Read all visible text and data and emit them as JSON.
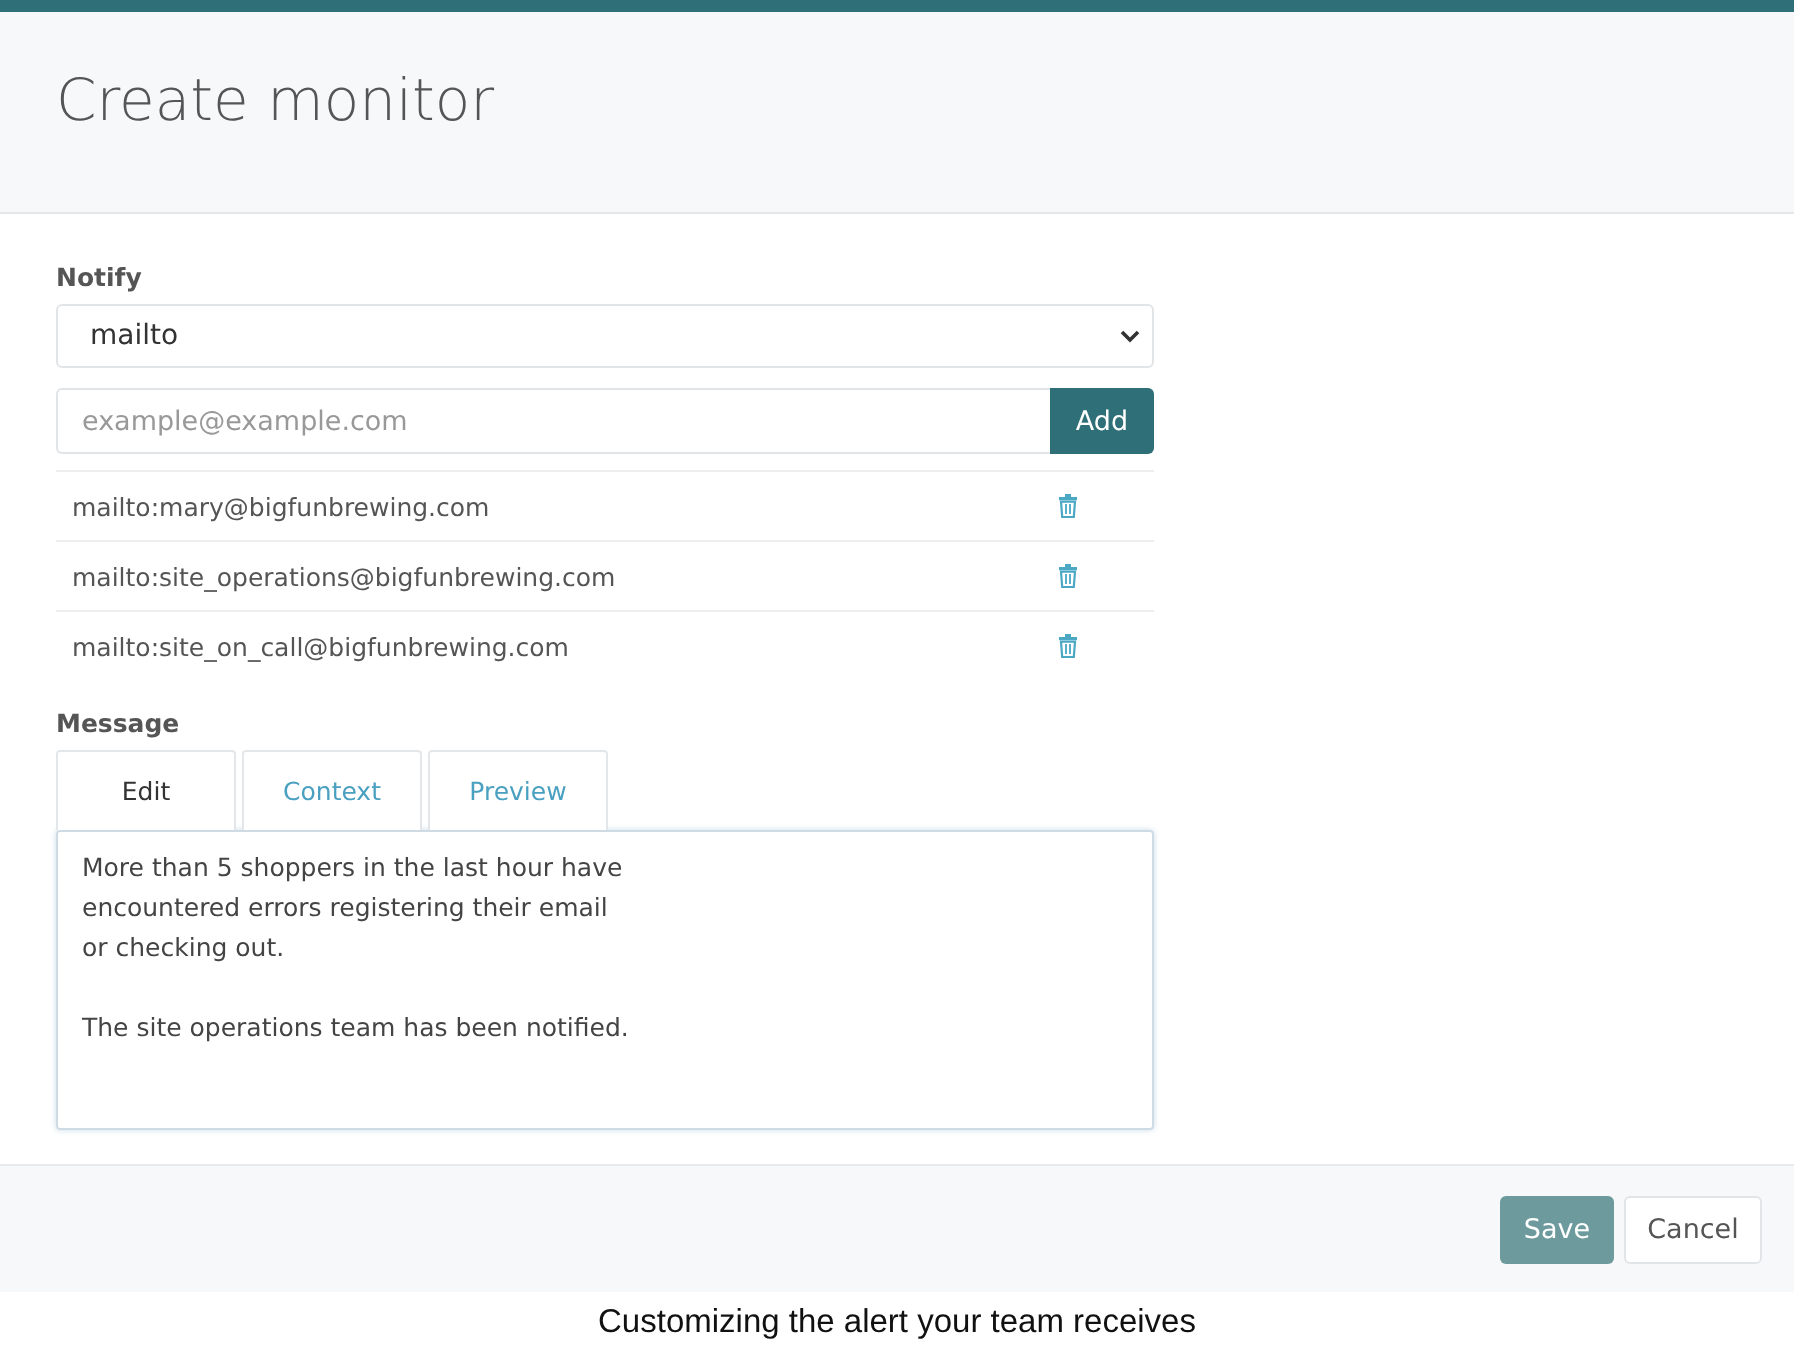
{
  "dialog": {
    "title": "Create monitor"
  },
  "notify": {
    "label": "Notify",
    "channel": "mailto",
    "placeholder": "example@example.com",
    "add_button": "Add",
    "recipients": [
      {
        "address": "mailto:mary@bigfunbrewing.com"
      },
      {
        "address": "mailto:site_operations@bigfunbrewing.com"
      },
      {
        "address": "mailto:site_on_call@bigfunbrewing.com"
      }
    ]
  },
  "message": {
    "label": "Message",
    "tabs": [
      {
        "label": "Edit",
        "selected": true
      },
      {
        "label": "Context",
        "selected": false
      },
      {
        "label": "Preview",
        "selected": false
      }
    ],
    "value": "More than 5 shoppers in the last hour have\nencountered errors registering their email\nor checking out.\n\nThe site operations team has been notified."
  },
  "buttons": [
    {
      "label": "Save",
      "kind": "primary"
    },
    {
      "label": "Cancel",
      "kind": "secondary"
    }
  ],
  "caption": "Customizing the alert your team receives"
}
